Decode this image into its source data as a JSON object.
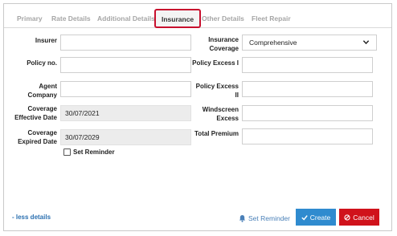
{
  "tabs": [
    {
      "label": "Primary"
    },
    {
      "label": "Rate Details"
    },
    {
      "label": "Additional Details"
    },
    {
      "label": "Insurance"
    },
    {
      "label": "Other Details"
    },
    {
      "label": "Fleet Repair"
    }
  ],
  "form": {
    "insurer_label": "Insurer",
    "insurer_value": "",
    "policy_no_label": "Policy no.",
    "policy_no_value": "",
    "agent_company_label_1": "Agent",
    "agent_company_label_2": "Company",
    "agent_company_value": "",
    "coverage_effective_label_1": "Coverage",
    "coverage_effective_label_2": "Effective Date",
    "coverage_effective_value": "30/07/2021",
    "coverage_expired_label_1": "Coverage",
    "coverage_expired_label_2": "Expired Date",
    "coverage_expired_value": "30/07/2029",
    "set_reminder_checkbox_label": "Set Reminder",
    "insurance_coverage_label_1": "Insurance",
    "insurance_coverage_label_2": "Coverage",
    "insurance_coverage_value": "Comprehensive",
    "policy_excess_1_label": "Policy Excess I",
    "policy_excess_1_value": "",
    "policy_excess_2_label_1": "Policy Excess",
    "policy_excess_2_label_2": "II",
    "policy_excess_2_value": "",
    "windscreen_label_1": "Windscreen",
    "windscreen_label_2": "Excess",
    "windscreen_value": "",
    "total_premium_label": "Total Premium",
    "total_premium_value": ""
  },
  "footer": {
    "less_details": "- less details",
    "set_reminder": "Set Reminder",
    "create": "Create",
    "cancel": "Cancel"
  },
  "colors": {
    "active_tab_border": "#c8102e",
    "create_button": "#2f8bcf",
    "cancel_button": "#d0121b",
    "link": "#2a6fb0"
  },
  "icons": {
    "dropdown": "chevron-down-icon",
    "reminder": "bell-icon",
    "create": "check-icon",
    "cancel": "ban-icon"
  }
}
